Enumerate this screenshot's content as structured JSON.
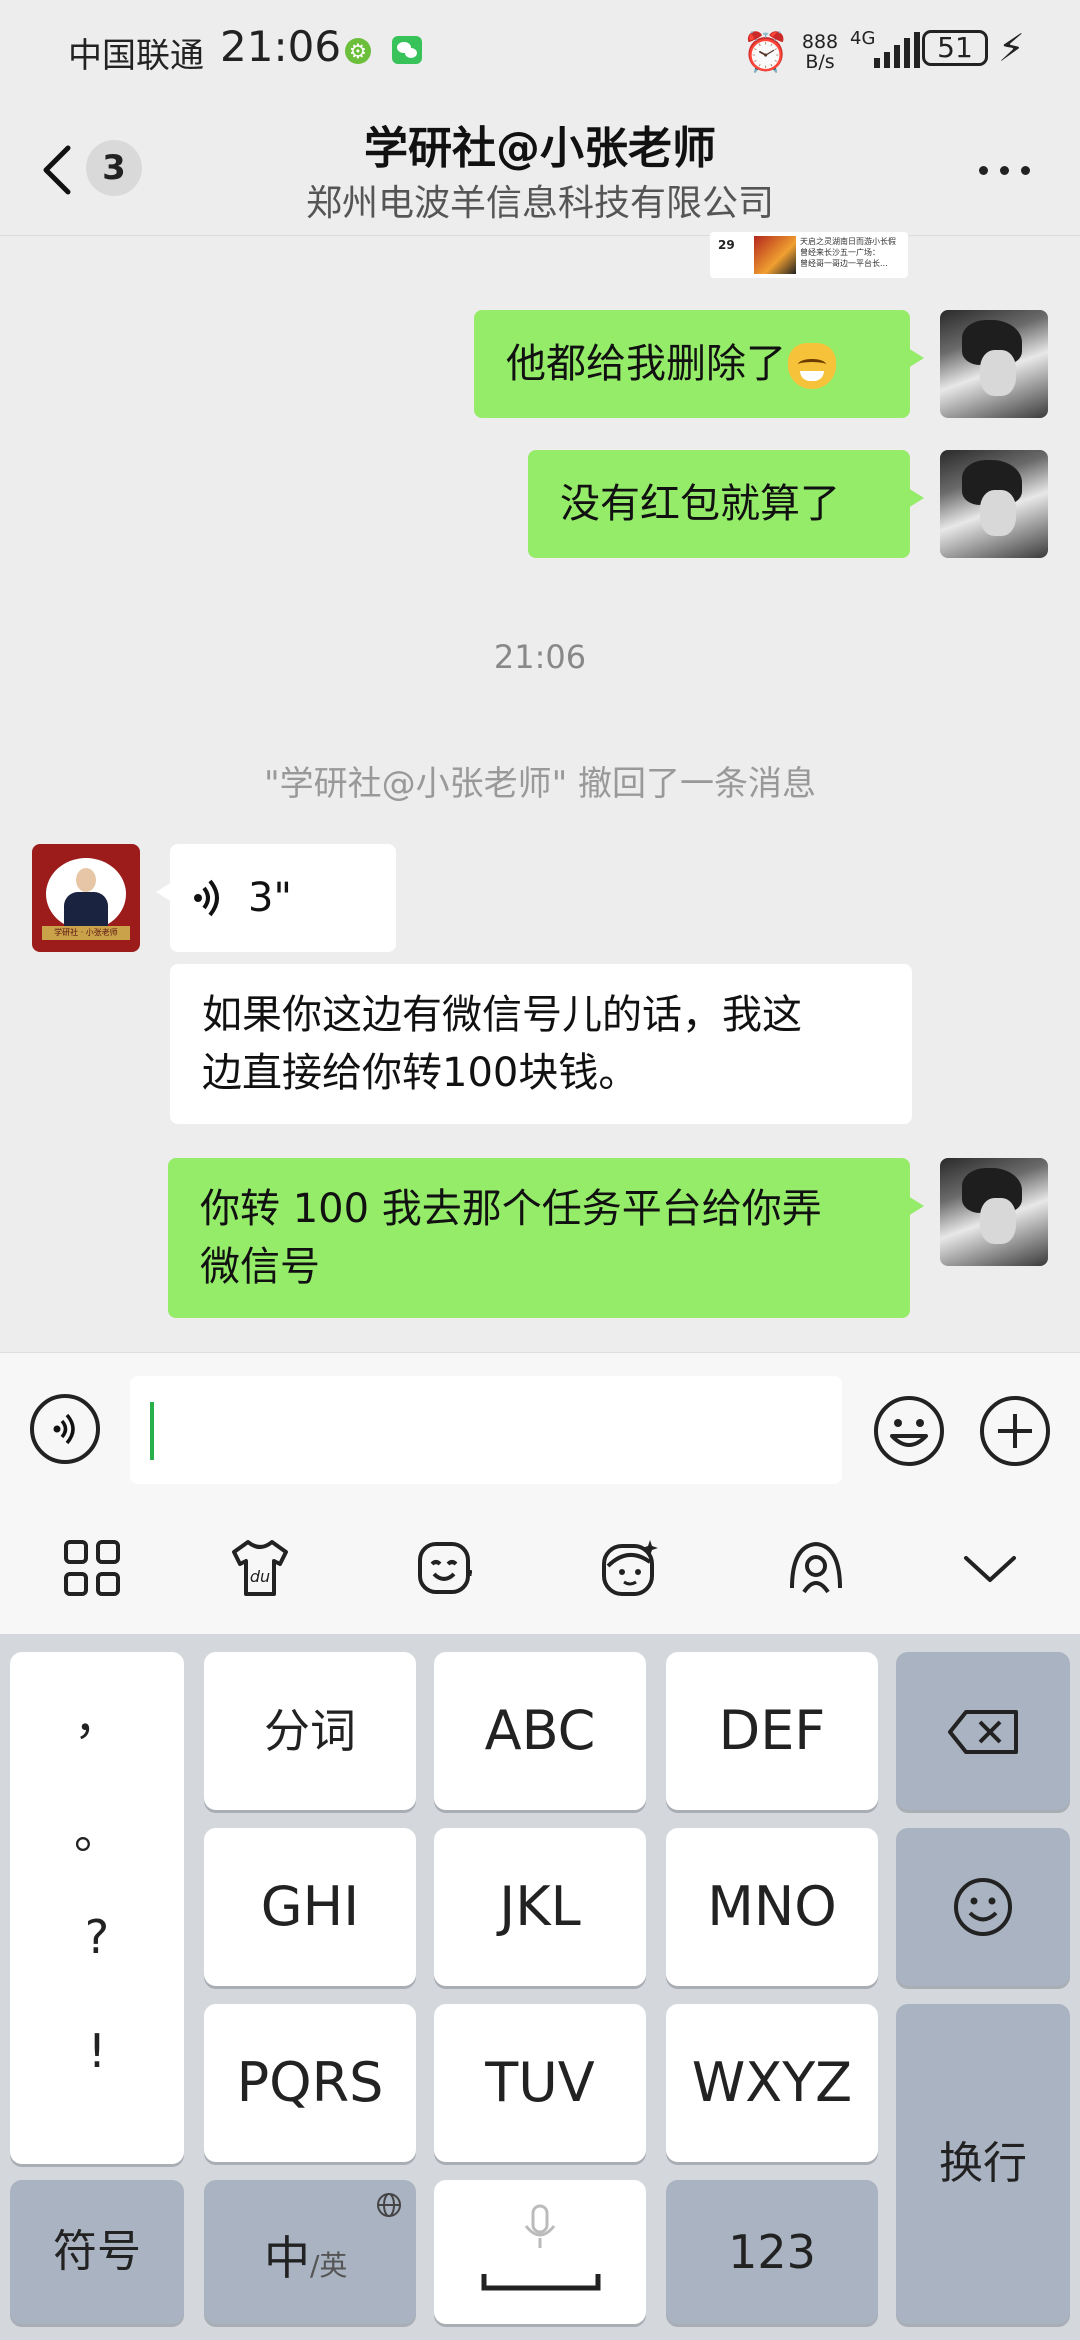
{
  "status_bar": {
    "carrier": "中国联通",
    "time": "21:06",
    "net_speed_top": "888",
    "net_speed_unit": "B/s",
    "network": "4G",
    "battery": "51"
  },
  "header": {
    "unread_count": "3",
    "title": "学研社@小张老师",
    "subtitle": "郑州电波羊信息科技有限公司"
  },
  "shared_card": {
    "badge": "29",
    "lines": [
      "天启之灵湖南日而游小长假",
      "曾经来长沙五一广场：",
      "曾经哥一哥边一平台长..."
    ]
  },
  "messages": [
    {
      "from": "me",
      "text": "他都给我删除了"
    },
    {
      "from": "me",
      "text": "没有红包就算了"
    },
    {
      "from": "them",
      "type": "voice",
      "text": "3\""
    },
    {
      "from": "them",
      "text_line1": "如果你这边有微信号儿的话，我这",
      "text_line2": "边直接给你转100块钱。"
    },
    {
      "from": "me",
      "text_line1": "你转 100 我去那个任务平台给你弄",
      "text_line2": "微信号"
    }
  ],
  "timestamp": "21:06",
  "recall_notice": "\"学研社@小张老师\" 撤回了一条消息",
  "avatar_them_caption": "学研社 · 小张老师",
  "input": {
    "value": ""
  },
  "keyboard": {
    "punctuation": [
      "，",
      "。",
      "?",
      "!"
    ],
    "row1": [
      "分词",
      "ABC",
      "DEF"
    ],
    "row2": [
      "GHI",
      "JKL",
      "MNO"
    ],
    "row3": [
      "PQRS",
      "TUV",
      "WXYZ"
    ],
    "symbols": "符号",
    "lang_main": "中",
    "lang_alt": "/英",
    "numbers": "123",
    "enter": "换行"
  }
}
